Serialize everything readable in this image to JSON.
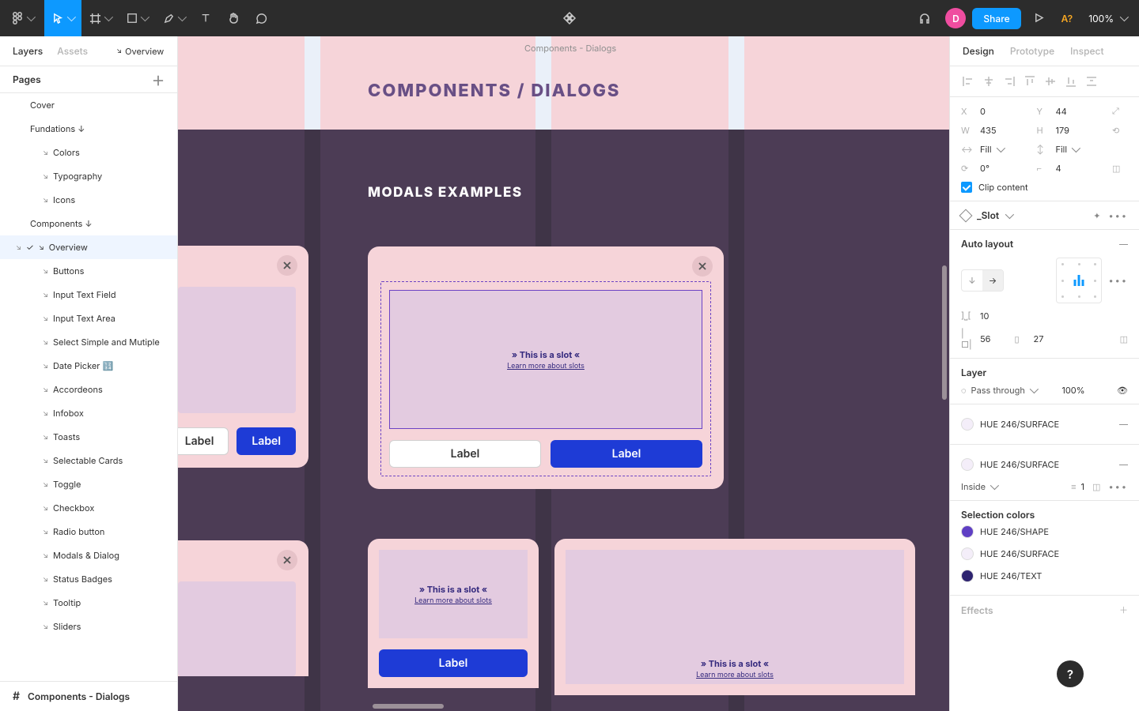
{
  "toolbar": {
    "zoom": "100%",
    "warn": "A?",
    "share": "Share",
    "avatar_initial": "D"
  },
  "left": {
    "tabs": {
      "layers": "Layers",
      "assets": "Assets",
      "overview": "Overview"
    },
    "pages_header": "Pages",
    "footer_label": "Components - Dialogs",
    "tree": {
      "cover": "Cover",
      "foundations": "Fundations ↓",
      "colors": "Colors",
      "typography": "Typography",
      "icons": "Icons",
      "components": "Components ↓",
      "overview": "Overview",
      "buttons": "Buttons",
      "input_text_field": "Input Text Field",
      "input_text_area": "Input Text Area",
      "select": "Select Simple and  Mutiple",
      "date_picker": "Date Picker 🔢",
      "accordions": "Accordeons",
      "infobox": "Infobox",
      "toasts": "Toasts",
      "selectable_cards": "Selectable Cards",
      "toggle": "Toggle",
      "checkbox": "Checkbox",
      "radio": "Radio button",
      "modals": "Modals & Dialog",
      "badges": "Status Badges",
      "tooltip": "Tooltip",
      "sliders": "Sliders"
    }
  },
  "canvas": {
    "artboard_title": "Components - Dialogs",
    "page_heading": "COMPONENTS / DIALOGS",
    "section_heading": "MODALS EXAMPLES",
    "slot_title": "This is a slot",
    "slot_link": "Learn more about slots",
    "btn_label": "Label"
  },
  "design": {
    "tabs": {
      "design": "Design",
      "prototype": "Prototype",
      "inspect": "Inspect"
    },
    "x_label": "X",
    "x": "0",
    "y_label": "Y",
    "y": "44",
    "w_label": "W",
    "w": "435",
    "h_label": "H",
    "h": "179",
    "fill_mode": "Fill",
    "rotation": "0°",
    "radius": "4",
    "clip_label": "Clip content",
    "slot_name": "_Slot",
    "auto_layout": "Auto layout",
    "gap": "10",
    "pad_h": "56",
    "pad_v": "27",
    "layer_title": "Layer",
    "pass_through": "Pass through",
    "opacity": "100%",
    "surface_name": "HUE 246/SURFACE",
    "inside": "Inside",
    "stroke_w": "1",
    "sel_title": "Selection colors",
    "shape_name": "HUE 246/SHAPE",
    "text_name": "HUE 246/TEXT",
    "effects_title": "Effects"
  }
}
